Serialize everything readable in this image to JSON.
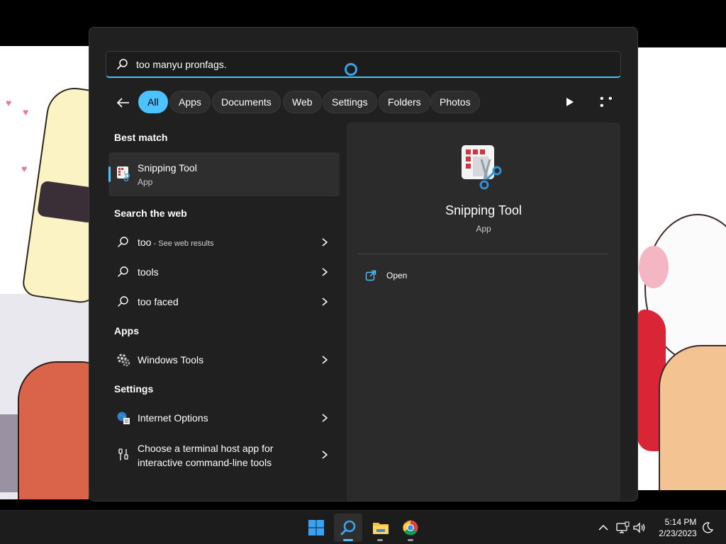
{
  "search": {
    "query": "too manyu pronfags."
  },
  "filters": {
    "items": [
      {
        "label": "All"
      },
      {
        "label": "Apps"
      },
      {
        "label": "Documents"
      },
      {
        "label": "Web"
      },
      {
        "label": "Settings"
      },
      {
        "label": "Folders"
      },
      {
        "label": "Photos"
      }
    ],
    "active": "All"
  },
  "results": {
    "best_match_title": "Best match",
    "best_match": {
      "name": "Snipping Tool",
      "type": "App",
      "icon": "snipping-tool-icon"
    },
    "web_title": "Search the web",
    "web": [
      {
        "label": "too",
        "suffix": " - See web results",
        "icon": "search-icon"
      },
      {
        "label": "tools",
        "icon": "search-icon"
      },
      {
        "label": "too faced",
        "icon": "search-icon"
      }
    ],
    "apps_title": "Apps",
    "apps": [
      {
        "label": "Windows Tools",
        "icon": "windows-tools-icon"
      }
    ],
    "settings_title": "Settings",
    "settings": [
      {
        "label": "Internet Options",
        "icon": "internet-options-icon"
      },
      {
        "label": "Choose a terminal host app for interactive command-line tools",
        "icon": "terminal-settings-icon"
      }
    ]
  },
  "preview": {
    "title": "Snipping Tool",
    "subtitle": "App",
    "actions": [
      {
        "label": "Open",
        "icon": "open-external-icon"
      }
    ]
  },
  "taskbar": {
    "apps": [
      {
        "name": "Start",
        "icon": "windows-start-icon"
      },
      {
        "name": "Search",
        "icon": "search-icon",
        "active": true
      },
      {
        "name": "File Explorer",
        "icon": "folder-icon"
      },
      {
        "name": "Google Chrome",
        "icon": "chrome-icon"
      }
    ],
    "tray": [
      "chevron-up-icon",
      "display-icon",
      "volume-icon"
    ],
    "clock": {
      "time": "5:14 PM",
      "date": "2/23/2023"
    },
    "focus_icon": "moon-icon"
  },
  "colors": {
    "accent": "#4cc2ff",
    "panel_bg": "#202020",
    "taskbar_bg": "#1c1c1c"
  }
}
